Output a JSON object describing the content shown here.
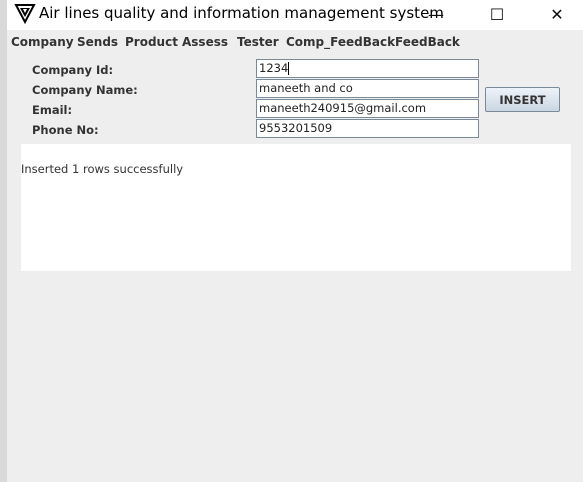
{
  "window": {
    "title": "Air lines quality and information management system",
    "controls": {
      "minimize": "—",
      "maximize": "☐",
      "close": "✕"
    }
  },
  "menu": {
    "items": [
      "Company",
      "Sends",
      "Product",
      "Assess",
      "Tester",
      "Comp_FeedBack",
      "FeedBack"
    ]
  },
  "form": {
    "company_id_label": "Company Id:",
    "company_id_value": "1234",
    "company_name_label": "Company Name:",
    "company_name_value": "maneeth and co",
    "email_label": "Email:",
    "email_value": "maneeth240915@gmail.com",
    "phone_label": "Phone No:",
    "phone_value": "9553201509",
    "insert_label": "INSERT"
  },
  "result": {
    "message": "Inserted 1 rows successfully"
  }
}
